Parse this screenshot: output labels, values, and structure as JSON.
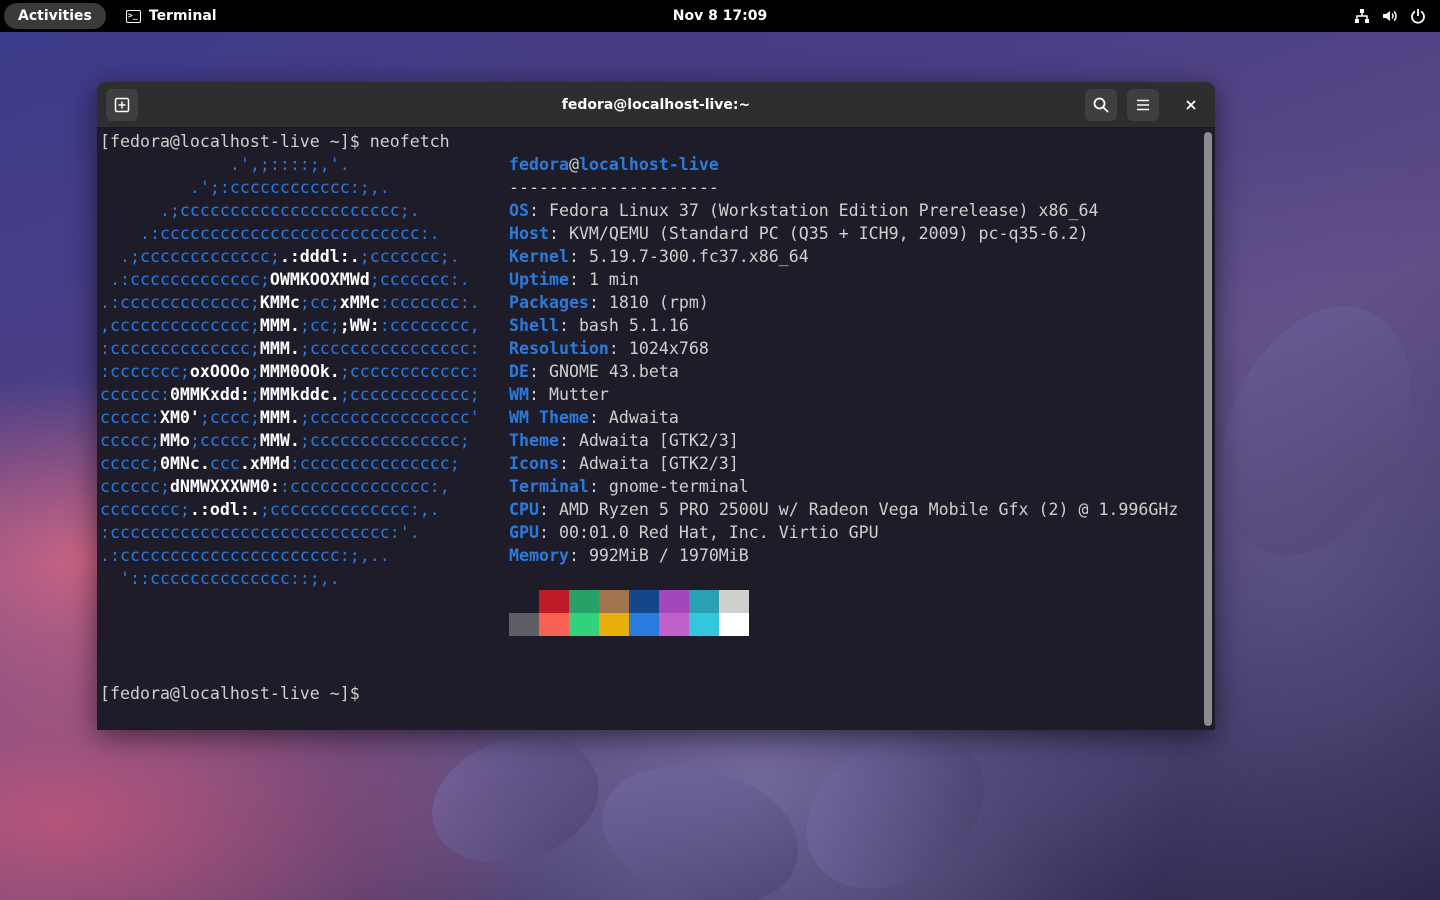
{
  "topbar": {
    "activities": "Activities",
    "app_name": "Terminal",
    "clock": "Nov 8  17:09",
    "tray": [
      "network-icon",
      "volume-icon",
      "power-icon"
    ]
  },
  "window": {
    "title": "fedora@localhost-live:~",
    "buttons": [
      "new-tab-icon",
      "search-icon",
      "hamburger-menu-icon",
      "close-icon"
    ]
  },
  "terminal": {
    "prompt_line": "[fedora@localhost-live ~]$ neofetch",
    "final_prompt": "[fedora@localhost-live ~]$",
    "logo": [
      "             .',;::::;,'.",
      "         .';:cccccccccccc:;,.",
      "      .;cccccccccccccccccccccc;.",
      "    .:cccccccccccccccccccccccccc:.",
      "  .;ccccccccccccc;.:dddl:.;ccccccc;.",
      " .:ccccccccccccc;OWMKOOXMWd;ccccccc:.",
      ".:ccccccccccccc;KMMc;cc;xMMc:ccccccc:.",
      ",cccccccccccccc;MMM.;cc;;WW::cccccccc,",
      ":cccccccccccccc;MMM.;cccccccccccccccc:",
      ":ccccccc;oxOOOo;MMM0OOk.;cccccccccccc:",
      "cccccc:0MMKxdd:;MMMkddc.;cccccccccccc;",
      "ccccc:XM0';cccc;MMM.;cccccccccccccccc'",
      "ccccc;MMo;ccccc;MMW.;ccccccccccccccc;",
      "ccccc;0MNc.ccc.xMMd:ccccccccccccccc;",
      "cccccc;dNMWXXXWM0::cccccccccccccc:,",
      "cccccccc;.:odl:.;cccccccccccccc:,.",
      ":cccccccccccccccccccccccccccc:'.",
      ".:cccccccccccccccccccccc:;,..",
      "  '::cccccccccccccc::;,."
    ],
    "user": "fedora",
    "at": "@",
    "host": "localhost-live",
    "separator": "---------------------",
    "info": [
      {
        "key": "OS",
        "value": "Fedora Linux 37 (Workstation Edition Prerelease) x86_64"
      },
      {
        "key": "Host",
        "value": "KVM/QEMU (Standard PC (Q35 + ICH9, 2009) pc-q35-6.2)"
      },
      {
        "key": "Kernel",
        "value": "5.19.7-300.fc37.x86_64"
      },
      {
        "key": "Uptime",
        "value": "1 min"
      },
      {
        "key": "Packages",
        "value": "1810 (rpm)"
      },
      {
        "key": "Shell",
        "value": "bash 5.1.16"
      },
      {
        "key": "Resolution",
        "value": "1024x768"
      },
      {
        "key": "DE",
        "value": "GNOME 43.beta"
      },
      {
        "key": "WM",
        "value": "Mutter"
      },
      {
        "key": "WM Theme",
        "value": "Adwaita"
      },
      {
        "key": "Theme",
        "value": "Adwaita [GTK2/3]"
      },
      {
        "key": "Icons",
        "value": "Adwaita [GTK2/3]"
      },
      {
        "key": "Terminal",
        "value": "gnome-terminal"
      },
      {
        "key": "CPU",
        "value": "AMD Ryzen 5 PRO 2500U w/ Radeon Vega Mobile Gfx (2) @ 1.996GHz"
      },
      {
        "key": "GPU",
        "value": "00:01.0 Red Hat, Inc. Virtio GPU"
      },
      {
        "key": "Memory",
        "value": "992MiB / 1970MiB"
      }
    ],
    "colors_top": [
      "#1e1c29",
      "#c01c28",
      "#26a269",
      "#a2734c",
      "#12488b",
      "#a347ba",
      "#2aa1b3",
      "#d0cfcc"
    ],
    "colors_bottom": [
      "#5e5c64",
      "#f66151",
      "#33d17a",
      "#e9ad0c",
      "#2a7bde",
      "#c061cb",
      "#33c7de",
      "#ffffff"
    ]
  }
}
